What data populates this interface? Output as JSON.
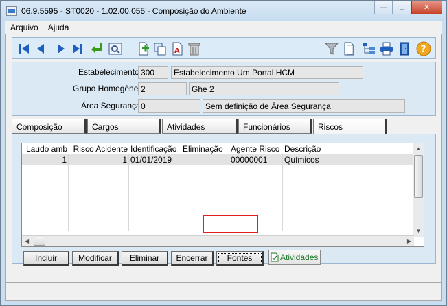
{
  "window": {
    "title": "06.9.5595 - ST0020 - 1.02.00.055 - Composição do Ambiente",
    "minimize_label": "—",
    "maximize_label": "□",
    "close_label": "✕"
  },
  "menu": {
    "items": [
      {
        "label": "Arquivo"
      },
      {
        "label": "Ajuda"
      }
    ]
  },
  "toolbar": {
    "icons": [
      "first-record-icon",
      "previous-record-icon",
      "next-record-icon",
      "last-record-icon",
      "return-icon",
      "zoom-icon",
      "new-icon",
      "copy-icon",
      "edit-text-icon",
      "delete-icon",
      "filter-icon",
      "document-icon",
      "tree-icon",
      "print-icon",
      "exit-icon",
      "help-icon"
    ]
  },
  "header": {
    "estabelecimento": {
      "label": "Estabelecimento:",
      "code": "300",
      "name": "Estabelecimento Um Portal HCM"
    },
    "grupo": {
      "label": "Grupo Homogêneo:",
      "code": "2",
      "name": "Ghe 2"
    },
    "area": {
      "label": "Área Segurança:",
      "code": "0",
      "name": "Sem definição de Área Segurança"
    }
  },
  "tabs": [
    {
      "label": "Composição"
    },
    {
      "label": "Cargos"
    },
    {
      "label": "Atividades"
    },
    {
      "label": "Funcionários"
    },
    {
      "label": "Riscos"
    }
  ],
  "grid": {
    "columns": [
      "Laudo amb",
      "Risco Acidente",
      "Identificação",
      "Eliminação",
      "Agente Risco",
      "Descrição"
    ],
    "rows": [
      {
        "laudo": "1",
        "risco": "1",
        "identificacao": "01/01/2019",
        "eliminacao": "",
        "agente": "00000001",
        "descricao": "Químicos"
      }
    ]
  },
  "buttons": {
    "incluir": "Incluir",
    "modificar": "Modificar",
    "eliminar": "Eliminar",
    "encerrar": "Encerrar",
    "fontes": "Fontes",
    "atividades": "Atividades"
  },
  "colors": {
    "accent_blue": "#1e5fc0",
    "highlight_red": "#e02020",
    "atividades_green": "#1a7a2a"
  }
}
